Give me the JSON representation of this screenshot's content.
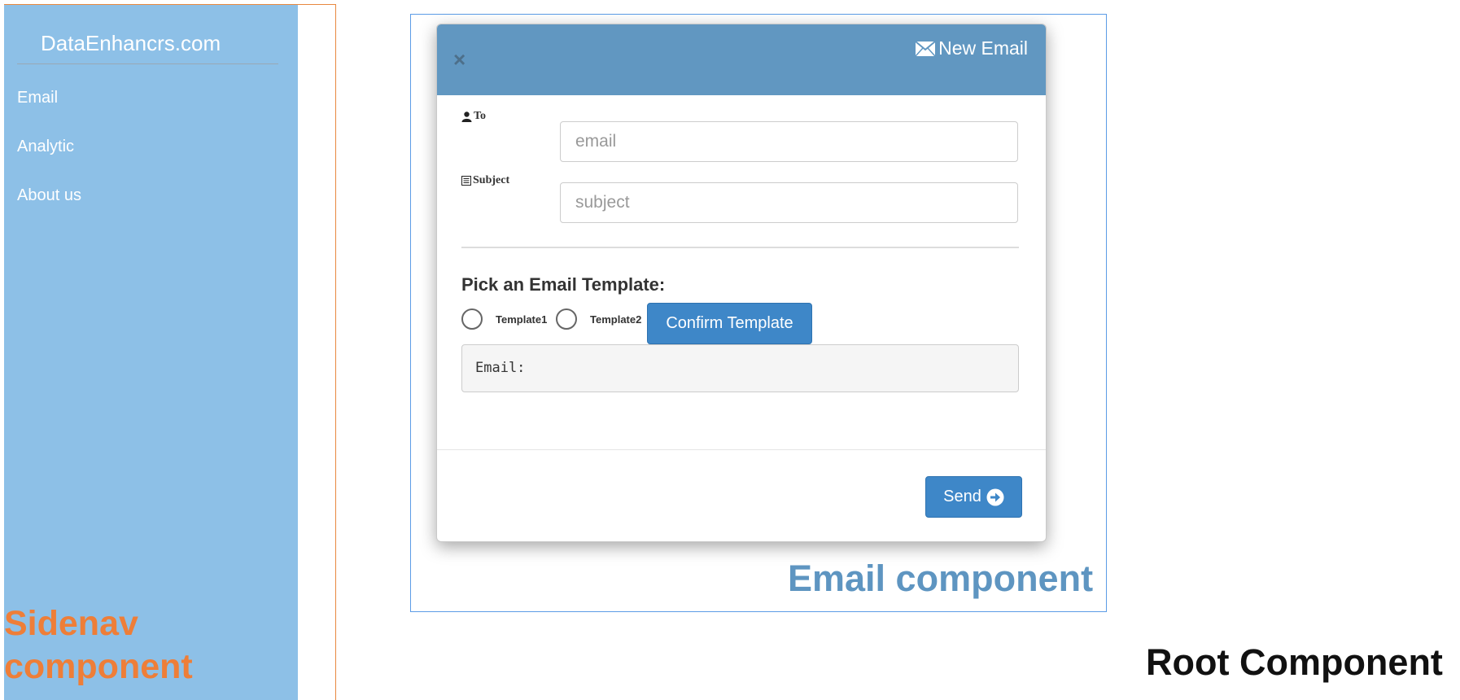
{
  "sidenav": {
    "brand": "DataEnhancrs.com",
    "items": [
      {
        "label": "Email"
      },
      {
        "label": "Analytic"
      },
      {
        "label": "About us"
      }
    ],
    "caption_line1": "Sidenav",
    "caption_line2": "component"
  },
  "email_component": {
    "caption": "Email component",
    "modal": {
      "close_label": "×",
      "title": "New Email",
      "title_icon": "envelope-icon",
      "to_label": "To",
      "to_icon": "user-icon",
      "to_placeholder": "email",
      "to_value": "",
      "subject_label": "Subject",
      "subject_icon": "list-icon",
      "subject_placeholder": "subject",
      "subject_value": "",
      "pick_label": "Pick an Email Template:",
      "templates": [
        {
          "label": "Template1",
          "selected": false
        },
        {
          "label": "Template2",
          "selected": false
        }
      ],
      "confirm_label": "Confirm Template",
      "preview_text": "Email:",
      "send_label": "Send",
      "send_icon": "arrow-circle-right-icon"
    }
  },
  "root_caption": "Root Component",
  "colors": {
    "sidenav_bg": "#8dc0e7",
    "sidenav_accent": "#ee7e38",
    "modal_header": "#6197c1",
    "button_primary": "#3e87c8",
    "email_caption": "#5e95c1"
  }
}
